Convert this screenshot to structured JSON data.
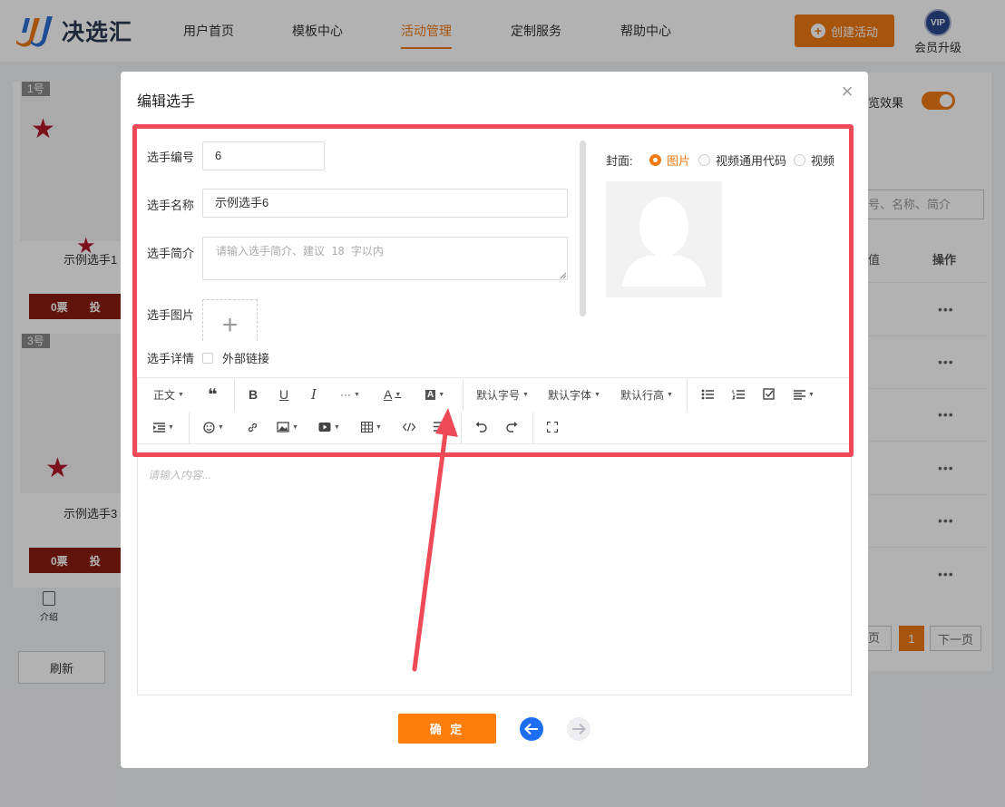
{
  "logo": {
    "text": "决选汇"
  },
  "nav": {
    "items": [
      "用户首页",
      "模板中心",
      "活动管理",
      "定制服务",
      "帮助中心"
    ],
    "active_index": 2,
    "create_label": "创建活动",
    "vip_badge": "VIP",
    "vip_label": "会员升级"
  },
  "background": {
    "cards": [
      {
        "tag": "1号",
        "name": "示例选手1",
        "votes": "0票",
        "action": "投"
      },
      {
        "tag": "3号",
        "name": "示例选手3",
        "votes": "0票",
        "action": "投"
      }
    ],
    "intro_label": "介绍",
    "refresh_label": "刷新",
    "preview_label": "览效果",
    "search_placeholder": "号、名称、简介",
    "column_partial": "值",
    "column_actions": "操作",
    "row_dots": "•••",
    "prev_page_partial": "页",
    "current_page": "1",
    "next_page": "下一页"
  },
  "modal": {
    "title": "编辑选手",
    "close": "×",
    "fields": {
      "number_label": "选手编号",
      "number_value": "6",
      "name_label": "选手名称",
      "name_value": "示例选手6",
      "intro_label": "选手简介",
      "intro_placeholder": "请输入选手简介、建议 18 字以内",
      "image_label": "选手图片",
      "upload_symbol": "+",
      "detail_label": "选手详情",
      "external_link_label": "外部链接"
    },
    "cover": {
      "label": "封面:",
      "options": [
        "图片",
        "视频通用代码",
        "视频"
      ],
      "selected_index": 0
    },
    "toolbar": {
      "paragraph": "正文",
      "quote": "❝",
      "bold": "B",
      "underline": "U",
      "italic": "I",
      "more": "···",
      "font_color": "A",
      "bg_color": "A",
      "font_size": "默认字号",
      "font_family": "默认字体",
      "line_height": "默认行高"
    },
    "editor_placeholder": "请输入内容...",
    "confirm_label": "确 定"
  },
  "colors": {
    "accent": "#f07a14",
    "confirm": "#ff7d0a",
    "highlight": "#ef4a58",
    "prev_arrow": "#1c6ef2"
  }
}
